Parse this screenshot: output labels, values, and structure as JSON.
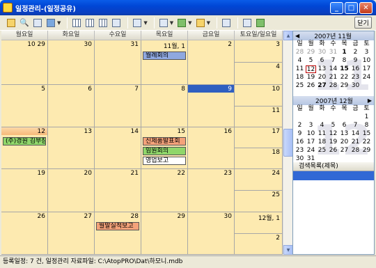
{
  "window": {
    "title": "일정관리-(일정공유)"
  },
  "toolbar": {
    "close_label": "닫기"
  },
  "calendar": {
    "weekday_headers": [
      "월요일",
      "화요일",
      "수요일",
      "목요일",
      "금요일",
      "토요일/일요일"
    ],
    "weeks": [
      {
        "days": [
          "10 29",
          "30",
          "31",
          "11월, 1",
          "2"
        ],
        "sat": "3",
        "sun": "4"
      },
      {
        "days": [
          "5",
          "6",
          "7",
          "8",
          "9"
        ],
        "sat": "10",
        "sun": "11"
      },
      {
        "days": [
          "12",
          "13",
          "14",
          "15",
          "16"
        ],
        "sat": "17",
        "sun": "18"
      },
      {
        "days": [
          "19",
          "20",
          "21",
          "22",
          "23"
        ],
        "sat": "24",
        "sun": "25"
      },
      {
        "days": [
          "26",
          "27",
          "28",
          "29",
          "30"
        ],
        "sat": "12월, 1",
        "sun": "2"
      }
    ],
    "events": [
      {
        "label": "월례회의",
        "color": "#8fa8e0"
      },
      {
        "label": "(주)경원 김부장",
        "color": "#8fd66a"
      },
      {
        "label": "신제품발표회",
        "color": "#f4a27a"
      },
      {
        "label": "임원회의",
        "color": "#8fd66a"
      },
      {
        "label": "영업보고",
        "color": "#ffffff"
      },
      {
        "label": "월말실적보고",
        "color": "#f4a27a"
      }
    ]
  },
  "mini_nov": {
    "title": "2007년 11월",
    "weekdays": [
      "일",
      "월",
      "화",
      "수",
      "목",
      "금",
      "토"
    ],
    "rows": [
      [
        "28",
        "29",
        "30",
        "31",
        "1",
        "2",
        "3"
      ],
      [
        "4",
        "5",
        "6",
        "7",
        "8",
        "9",
        "10"
      ],
      [
        "11",
        "12",
        "13",
        "14",
        "15",
        "16",
        "17"
      ],
      [
        "18",
        "19",
        "20",
        "21",
        "22",
        "23",
        "24"
      ],
      [
        "25",
        "26",
        "27",
        "28",
        "29",
        "30",
        ""
      ]
    ]
  },
  "mini_dec": {
    "title": "2007년 12월",
    "weekdays": [
      "일",
      "월",
      "화",
      "수",
      "목",
      "금",
      "토"
    ],
    "rows": [
      [
        "",
        "",
        "",
        "",
        "",
        "",
        "1"
      ],
      [
        "2",
        "3",
        "4",
        "5",
        "6",
        "7",
        "8"
      ],
      [
        "9",
        "10",
        "11",
        "12",
        "13",
        "14",
        "15"
      ],
      [
        "16",
        "17",
        "18",
        "19",
        "20",
        "21",
        "22"
      ],
      [
        "23",
        "24",
        "25",
        "26",
        "27",
        "28",
        "29"
      ],
      [
        "30",
        "31",
        "",
        "",
        "",
        "",
        ""
      ]
    ]
  },
  "search": {
    "header": "검색목록(제목)"
  },
  "status": {
    "text": "등록일정: 7 건,   일정관리 자료파일:  C:\\AtopPRO\\Dat\\하모니.mdb"
  }
}
